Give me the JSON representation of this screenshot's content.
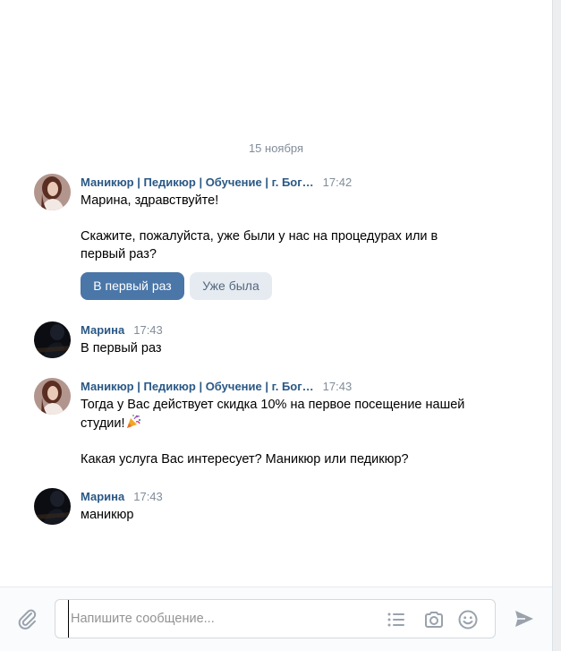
{
  "chat": {
    "date_divider": "15 ноября",
    "messages": [
      {
        "author": "Маникюр | Педикюр | Обучение | г. Бог…",
        "time": "17:42",
        "lines": [
          "Марина, здравствуйте!",
          "",
          "Скажите, пожалуйста, уже были у нас на процедурах или в",
          "первый раз?"
        ],
        "buttons": [
          "В первый раз",
          "Уже была"
        ]
      },
      {
        "author": "Марина",
        "time": "17:43",
        "lines": [
          "В первый раз"
        ]
      },
      {
        "author": "Маникюр | Педикюр | Обучение | г. Бог…",
        "time": "17:43",
        "lines": [
          "Тогда у Вас действует скидка 10% на первое посещение нашей",
          "студии!",
          "",
          "Какая услуга Вас интересует? Маникюр или педикюр?"
        ],
        "emoji": "party-popper-icon"
      },
      {
        "author": "Марина",
        "time": "17:43",
        "lines": [
          "маникюр"
        ]
      }
    ]
  },
  "composer": {
    "placeholder": "Напишите сообщение...",
    "value": "",
    "icons": [
      "paperclip-icon",
      "list-icon",
      "camera-icon",
      "smile-icon",
      "send-icon"
    ]
  },
  "colors": {
    "author": "#2a5885",
    "meta": "#818c99",
    "primary_button": "#4a76a8",
    "secondary_button": "#e5ebf1"
  }
}
